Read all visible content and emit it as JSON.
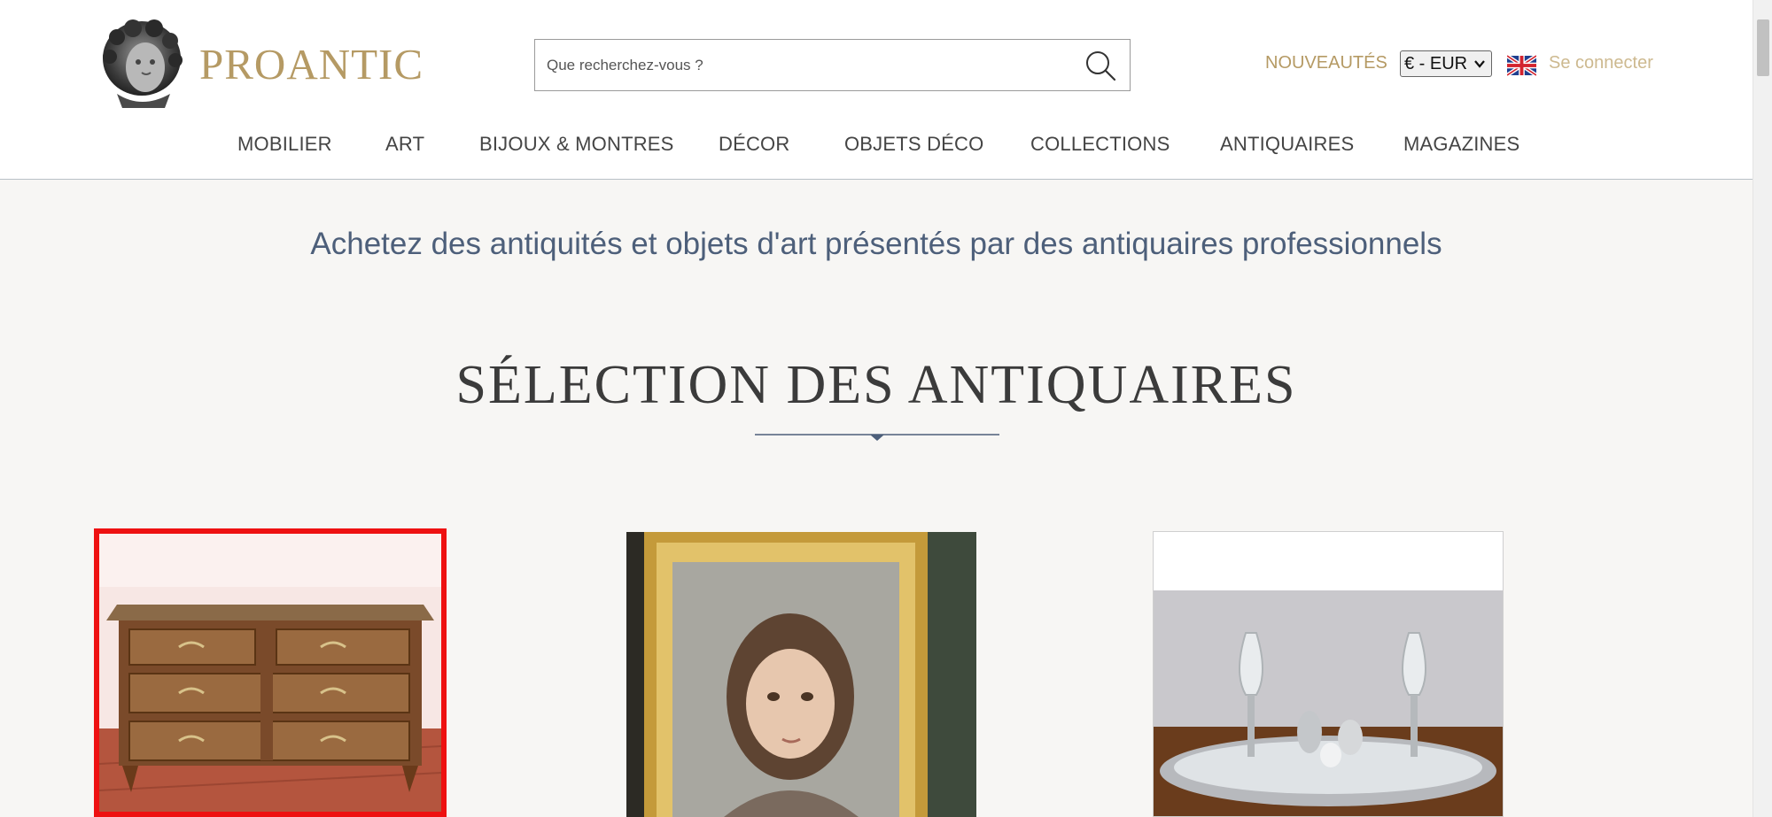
{
  "header": {
    "brand": "PROANTIC",
    "search": {
      "placeholder": "Que recherchez-vous ?"
    },
    "new_label": "NOUVEAUTÉS",
    "currency": "€ - EUR",
    "language_flag": "uk-flag-icon",
    "login_label": "Se connecter"
  },
  "nav": {
    "items": [
      "MOBILIER",
      "ART",
      "BIJOUX & MONTRES",
      "DÉCOR",
      "OBJETS DÉCO",
      "COLLECTIONS",
      "ANTIQUAIRES",
      "MAGAZINES"
    ]
  },
  "main": {
    "tagline": "Achetez des antiquités et objets d'art présentés par des antiquaires professionnels",
    "section_title": "SÉLECTION DES ANTIQUAIRES",
    "products": [
      {
        "icon": "commode-image",
        "selected": true
      },
      {
        "icon": "portrait-painting-image",
        "selected": false
      },
      {
        "icon": "silver-tray-image",
        "selected": false
      }
    ]
  },
  "colors": {
    "brand_gold": "#b59a64",
    "nav_text": "#444444",
    "tagline": "#4d5f7a",
    "selection_border": "#ee1111",
    "page_bg": "#f7f6f4"
  }
}
